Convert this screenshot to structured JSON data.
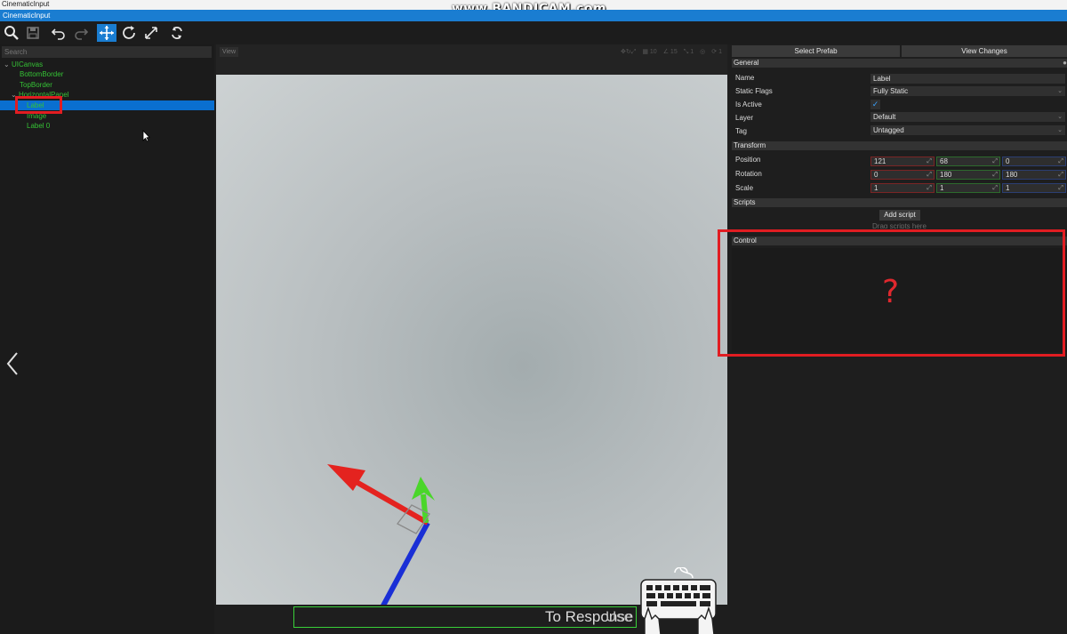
{
  "os_window_title": "CinematicInput",
  "watermark": "www.BANDICAM.com",
  "app_title": "CinematicInput",
  "toolbar": {
    "buttons": [
      "search-icon",
      "save-icon",
      "undo-icon",
      "redo-icon",
      "translate-gizmo-icon",
      "rotate-gizmo-icon",
      "scale-gizmo-icon",
      "refresh-icon"
    ],
    "active": "translate-gizmo-icon"
  },
  "scene_tree": {
    "search_placeholder": "Search",
    "items": [
      {
        "label": "UICanvas",
        "depth": 0,
        "expanded": true
      },
      {
        "label": "BottomBorder",
        "depth": 1
      },
      {
        "label": "TopBorder",
        "depth": 1
      },
      {
        "label": "HorizontalPanel",
        "depth": 1,
        "expanded": true
      },
      {
        "label": "Label",
        "depth": 2,
        "selected": true
      },
      {
        "label": "Image",
        "depth": 2
      },
      {
        "label": "Label 0",
        "depth": 2
      }
    ]
  },
  "viewport": {
    "view_label": "View",
    "tool_values": [
      "10",
      "15",
      "1",
      "1"
    ],
    "response_text": "To Response",
    "overlay_text": "Use"
  },
  "properties": {
    "select_prefab": "Select Prefab",
    "view_changes": "View Changes",
    "general": {
      "header": "General",
      "name_label": "Name",
      "name_value": "Label",
      "static_flags_label": "Static Flags",
      "static_flags_value": "Fully Static",
      "is_active_label": "Is Active",
      "is_active": true,
      "layer_label": "Layer",
      "layer_value": "Default",
      "tag_label": "Tag",
      "tag_value": "Untagged"
    },
    "transform": {
      "header": "Transform",
      "position_label": "Position",
      "position": [
        "121",
        "68",
        "0"
      ],
      "rotation_label": "Rotation",
      "rotation": [
        "0",
        "180",
        "180"
      ],
      "scale_label": "Scale",
      "scale": [
        "1",
        "1",
        "1"
      ]
    },
    "scripts": {
      "header": "Scripts",
      "add_script": "Add script",
      "drag_hint": "Drag scripts here"
    },
    "control": {
      "header": "Control"
    }
  },
  "annotation": {
    "question_mark": "?",
    "color": "#e11d22"
  }
}
